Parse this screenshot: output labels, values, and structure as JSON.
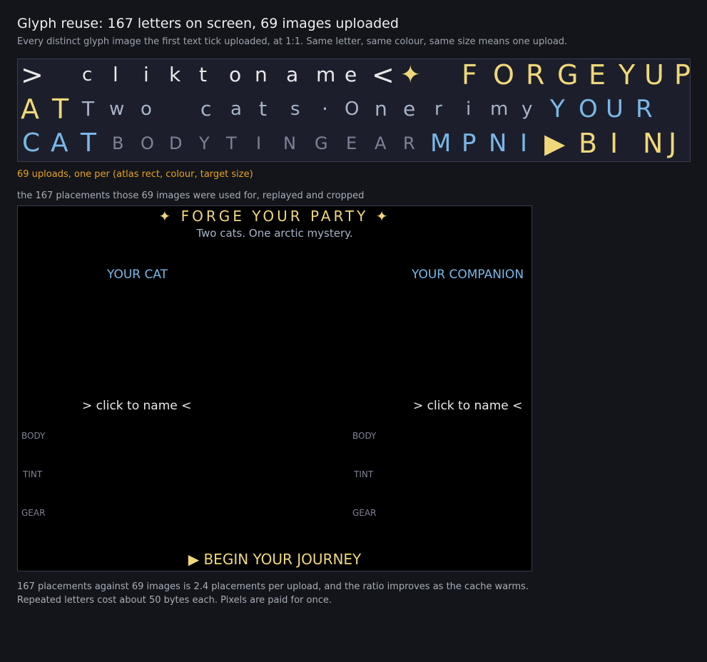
{
  "header": {
    "title": "Glyph reuse: 167 letters on screen, 69 images uploaded",
    "subtitle": "Every distinct glyph image the first text tick uploaded, at 1:1. Same letter, same colour, same size means one upload."
  },
  "atlas": {
    "rows": [
      {
        "glyphs": [
          {
            "ch": ">",
            "color": "#e8e8e8"
          },
          {
            "ch": "c",
            "color": "#e8e8e8"
          },
          {
            "ch": "l",
            "color": "#e8e8e8"
          },
          {
            "ch": "i",
            "color": "#e8e8e8"
          },
          {
            "ch": "k",
            "color": "#e8e8e8"
          },
          {
            "ch": "t",
            "color": "#e8e8e8"
          },
          {
            "ch": "o",
            "color": "#e8e8e8"
          },
          {
            "ch": "n",
            "color": "#e8e8e8"
          },
          {
            "ch": "a",
            "color": "#e8e8e8"
          },
          {
            "ch": "m",
            "color": "#e8e8e8"
          },
          {
            "ch": "e",
            "color": "#e8e8e8"
          },
          {
            "ch": "<",
            "color": "#e8e8e8"
          },
          {
            "ch": "✦",
            "color": "#f0d77a"
          },
          {
            "ch": "F",
            "color": "#f0d77a"
          },
          {
            "ch": "O",
            "color": "#f0d77a"
          },
          {
            "ch": "R",
            "color": "#f0d77a"
          },
          {
            "ch": "G",
            "color": "#f0d77a"
          },
          {
            "ch": "E",
            "color": "#f0d77a"
          },
          {
            "ch": "Y",
            "color": "#f0d77a"
          },
          {
            "ch": "U",
            "color": "#f0d77a"
          },
          {
            "ch": "P",
            "color": "#f0d77a"
          }
        ]
      },
      {
        "glyphs": [
          {
            "ch": "A",
            "color": "#f0d77a"
          },
          {
            "ch": "T",
            "color": "#f0d77a"
          },
          {
            "ch": "T",
            "color": "#a7b3c8"
          },
          {
            "ch": "w",
            "color": "#a7b3c8"
          },
          {
            "ch": "o",
            "color": "#a7b3c8"
          },
          {
            "ch": "c",
            "color": "#a7b3c8"
          },
          {
            "ch": "a",
            "color": "#a7b3c8"
          },
          {
            "ch": "t",
            "color": "#a7b3c8"
          },
          {
            "ch": "s",
            "color": "#a7b3c8"
          },
          {
            "ch": "·",
            "color": "#a7b3c8"
          },
          {
            "ch": "O",
            "color": "#a7b3c8"
          },
          {
            "ch": "n",
            "color": "#a7b3c8"
          },
          {
            "ch": "e",
            "color": "#a7b3c8"
          },
          {
            "ch": "r",
            "color": "#a7b3c8"
          },
          {
            "ch": "i",
            "color": "#a7b3c8"
          },
          {
            "ch": "m",
            "color": "#a7b3c8"
          },
          {
            "ch": "y",
            "color": "#a7b3c8"
          },
          {
            "ch": "Y",
            "color": "#7ab7e8"
          },
          {
            "ch": "O",
            "color": "#7ab7e8"
          },
          {
            "ch": "U",
            "color": "#7ab7e8"
          },
          {
            "ch": "R",
            "color": "#7ab7e8"
          }
        ]
      },
      {
        "glyphs": [
          {
            "ch": "C",
            "color": "#7ab7e8"
          },
          {
            "ch": "A",
            "color": "#7ab7e8"
          },
          {
            "ch": "T",
            "color": "#7ab7e8"
          },
          {
            "ch": "B",
            "color": "#7e8296"
          },
          {
            "ch": "O",
            "color": "#7e8296"
          },
          {
            "ch": "D",
            "color": "#7e8296"
          },
          {
            "ch": "Y",
            "color": "#7e8296"
          },
          {
            "ch": "T",
            "color": "#7e8296"
          },
          {
            "ch": "I",
            "color": "#7e8296"
          },
          {
            "ch": "N",
            "color": "#7e8296"
          },
          {
            "ch": "G",
            "color": "#7e8296"
          },
          {
            "ch": "E",
            "color": "#7e8296"
          },
          {
            "ch": "A",
            "color": "#7e8296"
          },
          {
            "ch": "R",
            "color": "#7e8296"
          },
          {
            "ch": "M",
            "color": "#7ab7e8"
          },
          {
            "ch": "P",
            "color": "#7ab7e8"
          },
          {
            "ch": "N",
            "color": "#7ab7e8"
          },
          {
            "ch": "I",
            "color": "#7ab7e8"
          },
          {
            "ch": "▶",
            "color": "#f0d77a"
          },
          {
            "ch": "B",
            "color": "#f0d77a"
          },
          {
            "ch": "I",
            "color": "#f0d77a"
          },
          {
            "ch": "N",
            "color": "#f0d77a"
          },
          {
            "ch": "J",
            "color": "#f0d77a"
          }
        ]
      }
    ]
  },
  "uploads_note": "69 uploads, one per (atlas rect, colour, target size)",
  "replay_caption": "the 167 placements those 69 images were used for, replayed and cropped",
  "replay": {
    "title": "✦ FORGE YOUR PARTY ✦",
    "subtitle": "Two cats. One arctic mystery.",
    "your_cat": "YOUR CAT",
    "your_companion": "YOUR COMPANION",
    "click_left": "> click to name <",
    "click_right": "> click to name <",
    "body_label": "BODY",
    "tint_label": "TINT",
    "gear_label": "GEAR",
    "begin": "▶  BEGIN YOUR JOURNEY"
  },
  "footer": {
    "line1": "167 placements against 69 images is 2.4 placements per upload, and the ratio improves as the cache warms.",
    "line2": "Repeated letters cost about 50 bytes each. Pixels are paid for once."
  },
  "colors": {
    "background": "#13151b",
    "accent_gold": "#f0d77a",
    "accent_blue": "#7ab7e8",
    "uploads_orange": "#e8a317"
  }
}
